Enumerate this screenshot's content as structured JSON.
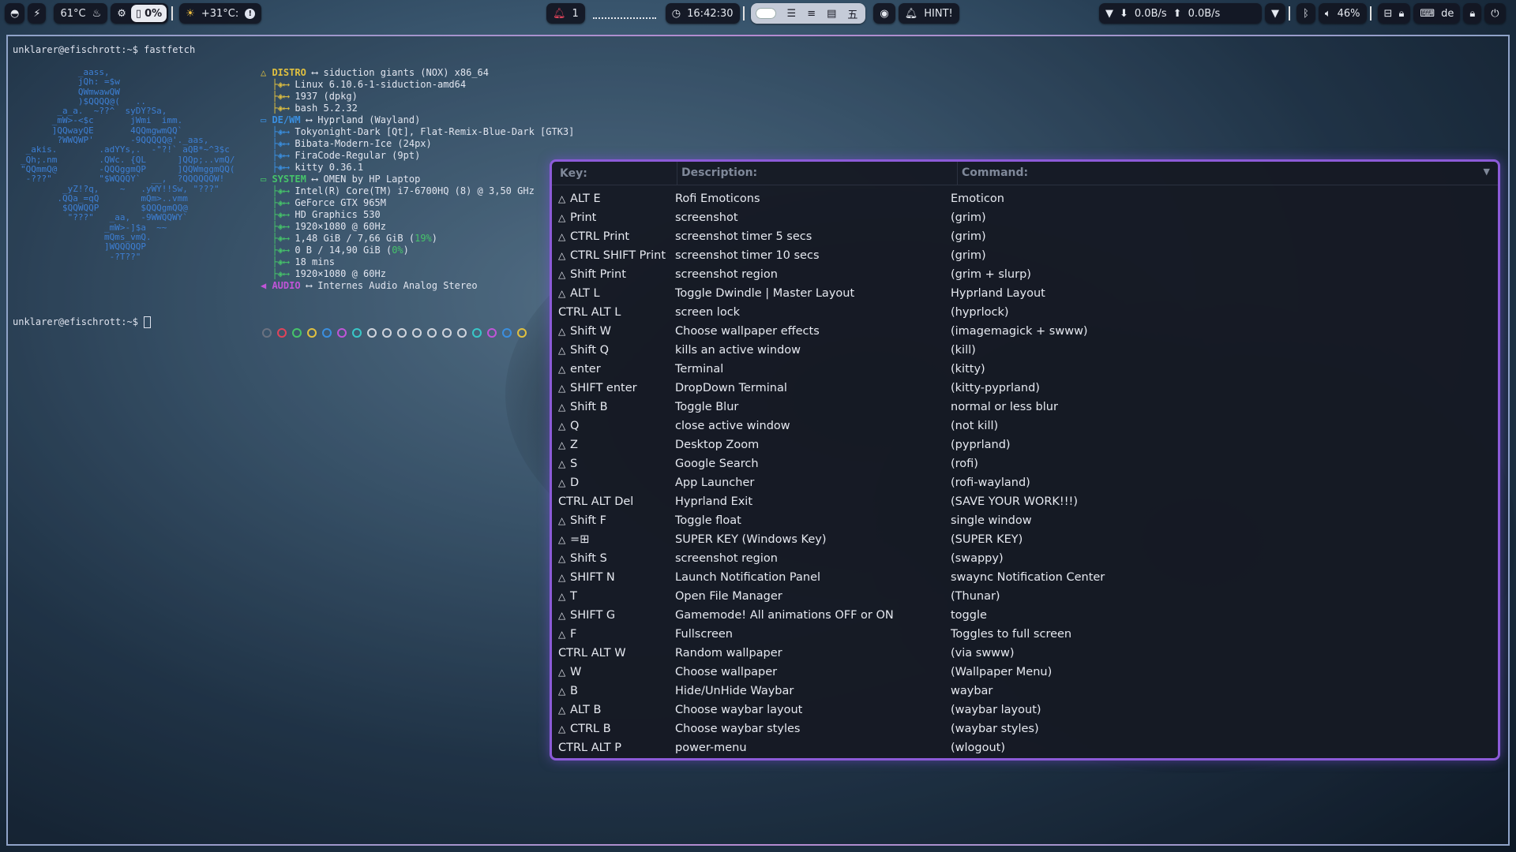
{
  "topbar": {
    "cpu_temp": "61°C",
    "battery_pct": "0%",
    "weather": "+31°C:",
    "notif_count": "1",
    "time": "16:42:30",
    "hint": "HINT!",
    "net_down": "0.0B/s",
    "net_up": "0.0B/s",
    "volume": "46%",
    "keyboard_layout": "de"
  },
  "terminal": {
    "prompt1": "unklarer@efischrott:~$ fastfetch",
    "prompt2": "unklarer@efischrott:~$ ",
    "logo": "           _aass,\n           jQh: =$w\n           QWmwawQW\n           )$QQQQ@(   ..\n       _a_a.  ~??^  syDY?Sa,\n      _mW>-<$c       jWmi  imm.\n      ]QQwayQE       4QQmgwmQQ`\n       ?WWQWP'       -9QQQQQ@'._aas,\n _akis.        .adYYs,.  -\"?!` aQB*~^3$c\n_Qh;.nm        .QWc. {QL      ]QQp;..vmQ/\n\"QQmmQ@        -QQQggmQP      ]QQWmggmQQ(\n -???\"         \"$WQQQY`  __,  ?QQQQQQW!\n        _yZ!?q,    ~   .yWY!!Sw, \"???\"\n       .QQa_=qQ        mQm>..vmm\n        $QQWQQP        $QQQgmQQ@\n         \"???\"   _aa,  -9WWQQWY`\n                _mW>-]$a  ~~\n                mQms_vmQ.\n                ]WQQQQQP\n                 -?T??\"",
    "info_lines": [
      {
        "label": "DISTRO",
        "value": "siduction giants (NOX) x86_64"
      },
      {
        "label": "",
        "value": "Linux 6.10.6-1-siduction-amd64"
      },
      {
        "label": "",
        "value": "1937 (dpkg)"
      },
      {
        "label": "",
        "value": "bash 5.2.32"
      },
      {
        "label": "DE/WM",
        "value": "Hyprland (Wayland)"
      },
      {
        "label": "",
        "value": "Tokyonight-Dark [Qt], Flat-Remix-Blue-Dark [GTK3]"
      },
      {
        "label": "",
        "value": "Bibata-Modern-Ice (24px)"
      },
      {
        "label": "",
        "value": "FiraCode-Regular (9pt)"
      },
      {
        "label": "",
        "value": "kitty 0.36.1"
      },
      {
        "label": "SYSTEM",
        "value": "OMEN by HP Laptop"
      },
      {
        "label": "",
        "value": "Intel(R) Core(TM) i7-6700HQ (8) @ 3,50 GHz"
      },
      {
        "label": "",
        "value": "GeForce GTX 965M"
      },
      {
        "label": "",
        "value": "HD Graphics 530"
      },
      {
        "label": "",
        "value": "1920×1080 @ 60Hz"
      },
      {
        "label": "",
        "value": "1,48 GiB / 7,66 GiB",
        "pct": "19%"
      },
      {
        "label": "",
        "value": "0 B / 14,90 GiB",
        "pct": "0%"
      },
      {
        "label": "",
        "value": "18 mins"
      },
      {
        "label": "",
        "value": "1920×1080 @ 60Hz"
      },
      {
        "label": "AUDIO",
        "value": "Internes Audio Analog Stereo"
      }
    ],
    "swatch_colors": [
      "#6b7280",
      "#e0435a",
      "#46c46a",
      "#e0c040",
      "#3a8fe0",
      "#c055d8",
      "#38c8c8",
      "#d0d4dc",
      "#d0d4dc",
      "#d0d4dc",
      "#d0d4dc",
      "#d0d4dc",
      "#d0d4dc",
      "#d0d4dc",
      "#38c8c8",
      "#c055d8",
      "#3a8fe0",
      "#e0c040"
    ]
  },
  "keybinds": {
    "headers": {
      "key": "Key:",
      "description": "Description:",
      "command": "Command:"
    },
    "rows": [
      {
        "super": true,
        "key": "ALT E",
        "desc": "Rofi Emoticons",
        "cmd": "Emoticon"
      },
      {
        "super": true,
        "key": "Print",
        "desc": "screenshot",
        "cmd": "(grim)"
      },
      {
        "super": true,
        "key": "CTRL Print",
        "desc": "screenshot timer 5 secs",
        "cmd": "(grim)"
      },
      {
        "super": true,
        "key": "CTRL SHIFT Print",
        "desc": "screenshot timer 10 secs",
        "cmd": "(grim)"
      },
      {
        "super": true,
        "key": "Shift Print",
        "desc": "screenshot region",
        "cmd": "(grim + slurp)"
      },
      {
        "super": true,
        "key": "ALT L",
        "desc": "Toggle Dwindle | Master Layout",
        "cmd": "Hyprland Layout"
      },
      {
        "super": false,
        "key": "CTRL ALT L",
        "desc": "screen lock",
        "cmd": "(hyprlock)"
      },
      {
        "super": true,
        "key": "Shift W",
        "desc": "Choose wallpaper effects",
        "cmd": "(imagemagick + swww)"
      },
      {
        "super": true,
        "key": "Shift Q",
        "desc": "kills an active window",
        "cmd": "(kill)"
      },
      {
        "super": true,
        "key": "enter",
        "desc": "Terminal",
        "cmd": "(kitty)"
      },
      {
        "super": true,
        "key": "SHIFT enter",
        "desc": "DropDown Terminal",
        "cmd": "(kitty-pyprland)"
      },
      {
        "super": true,
        "key": "Shift B",
        "desc": "Toggle Blur",
        "cmd": "normal or less blur"
      },
      {
        "super": true,
        "key": "Q",
        "desc": "close active window",
        "cmd": "(not kill)"
      },
      {
        "super": true,
        "key": "Z",
        "desc": "Desktop Zoom",
        "cmd": "(pyprland)"
      },
      {
        "super": true,
        "key": "S",
        "desc": "Google Search",
        "cmd": "(rofi)"
      },
      {
        "super": true,
        "key": "D",
        "desc": "App Launcher",
        "cmd": "(rofi-wayland)"
      },
      {
        "super": false,
        "key": "CTRL ALT Del",
        "desc": "Hyprland Exit",
        "cmd": "(SAVE YOUR WORK!!!)"
      },
      {
        "super": true,
        "key": "Shift F",
        "desc": "Toggle float",
        "cmd": "single window"
      },
      {
        "super": true,
        "key": "=⊞",
        "desc": "SUPER KEY (Windows Key)",
        "cmd": "(SUPER KEY)"
      },
      {
        "super": true,
        "key": "Shift S",
        "desc": "screenshot region",
        "cmd": "(swappy)"
      },
      {
        "super": true,
        "key": "SHIFT N",
        "desc": "Launch Notification Panel",
        "cmd": "swaync Notification Center"
      },
      {
        "super": true,
        "key": "T",
        "desc": "Open File Manager",
        "cmd": "(Thunar)"
      },
      {
        "super": true,
        "key": "SHIFT G",
        "desc": "Gamemode! All animations OFF or ON",
        "cmd": "toggle"
      },
      {
        "super": true,
        "key": "F",
        "desc": "Fullscreen",
        "cmd": "Toggles to full screen"
      },
      {
        "super": false,
        "key": "CTRL ALT W",
        "desc": "Random wallpaper",
        "cmd": "(via swww)"
      },
      {
        "super": true,
        "key": "W",
        "desc": "Choose wallpaper",
        "cmd": "(Wallpaper Menu)"
      },
      {
        "super": true,
        "key": "B",
        "desc": "Hide/UnHide Waybar",
        "cmd": "waybar"
      },
      {
        "super": true,
        "key": "ALT B",
        "desc": "Choose waybar layout",
        "cmd": "(waybar layout)"
      },
      {
        "super": true,
        "key": "CTRL B",
        "desc": "Choose waybar styles",
        "cmd": "(waybar styles)"
      },
      {
        "super": false,
        "key": "CTRL ALT P",
        "desc": "power-menu",
        "cmd": "(wlogout)"
      }
    ]
  }
}
